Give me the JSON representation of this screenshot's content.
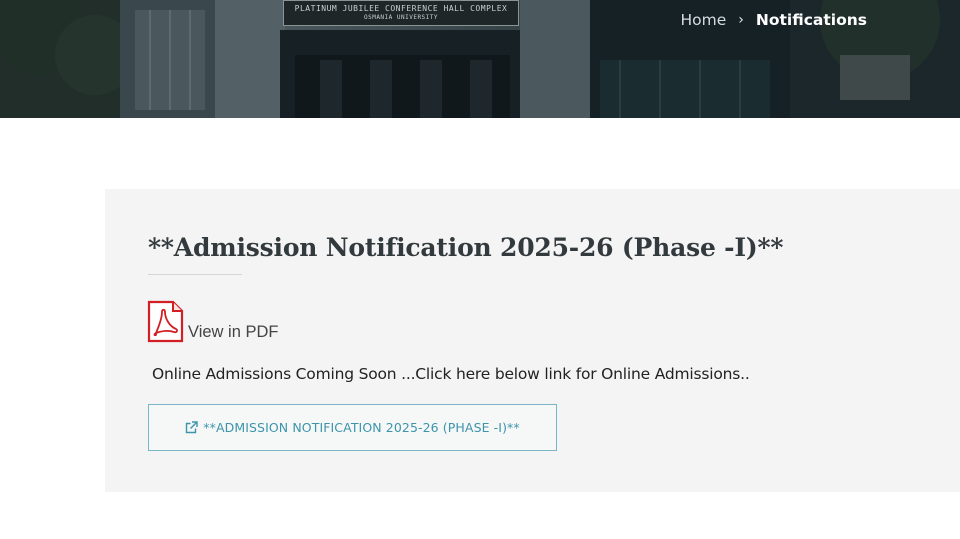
{
  "hero": {
    "building_sign_line1": "PLATINUM JUBILEE CONFERENCE HALL COMPLEX",
    "building_sign_line2": "OSMANIA UNIVERSITY"
  },
  "breadcrumb": {
    "home": "Home",
    "separator": "›",
    "current": "Notifications"
  },
  "notification": {
    "title": "**Admission Notification 2025-26 (Phase -I)**",
    "pdf_link_label": "View in PDF",
    "message": "Online Admissions Coming Soon ...Click here below link for Online Admissions..",
    "link_button_label": "**ADMISSION NOTIFICATION 2025-26 (PHASE -I)**"
  },
  "icons": {
    "pdf": "pdf-file-icon",
    "external_link": "external-link-icon"
  },
  "colors": {
    "card_background": "#f4f4f4",
    "link_accent": "#3d94ab",
    "pdf_red": "#d21f24"
  }
}
